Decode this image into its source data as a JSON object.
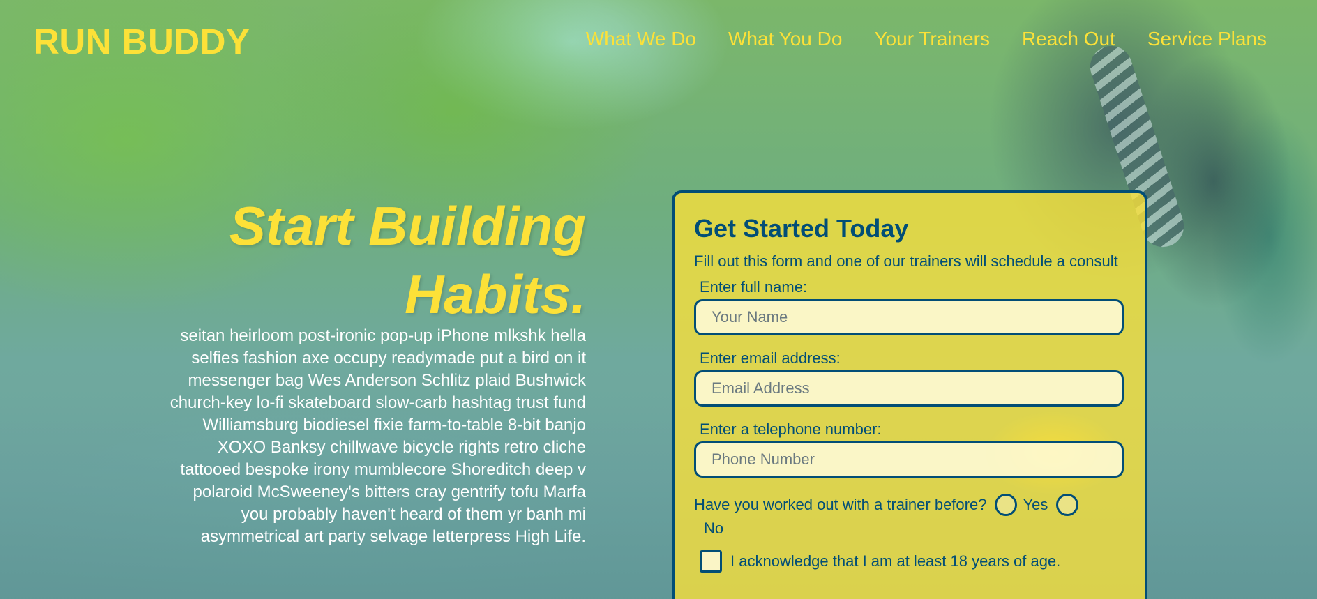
{
  "brand": "RUN BUDDY",
  "nav": [
    "What We Do",
    "What You Do",
    "Your Trainers",
    "Reach Out",
    "Service Plans"
  ],
  "hero": {
    "title_line1": "Start Building",
    "title_line2": "Habits.",
    "body": "seitan heirloom post-ironic pop-up iPhone mlkshk hella selfies fashion axe occupy readymade put a bird on it messenger bag Wes Anderson Schlitz plaid Bushwick church-key lo-fi skateboard slow-carb hashtag trust fund Williamsburg biodiesel fixie farm-to-table 8-bit banjo XOXO Banksy chillwave bicycle rights retro cliche tattooed bespoke irony mumblecore Shoreditch deep v polaroid McSweeney's bitters cray gentrify tofu Marfa you probably haven't heard of them yr banh mi asymmetrical art party selvage letterpress High Life."
  },
  "form": {
    "title": "Get Started Today",
    "subtitle": "Fill out this form and one of our trainers will schedule a consult",
    "name_label": "Enter full name:",
    "name_placeholder": "Your Name",
    "email_label": "Enter email address:",
    "email_placeholder": "Email Address",
    "phone_label": "Enter a telephone number:",
    "phone_placeholder": "Phone Number",
    "question": "Have you worked out with a trainer before?",
    "yes": "Yes",
    "no": "No",
    "acknowledge": "I acknowledge that I am at least 18 years of age."
  },
  "colors": {
    "accent": "#fce138",
    "primary": "#024e76"
  }
}
